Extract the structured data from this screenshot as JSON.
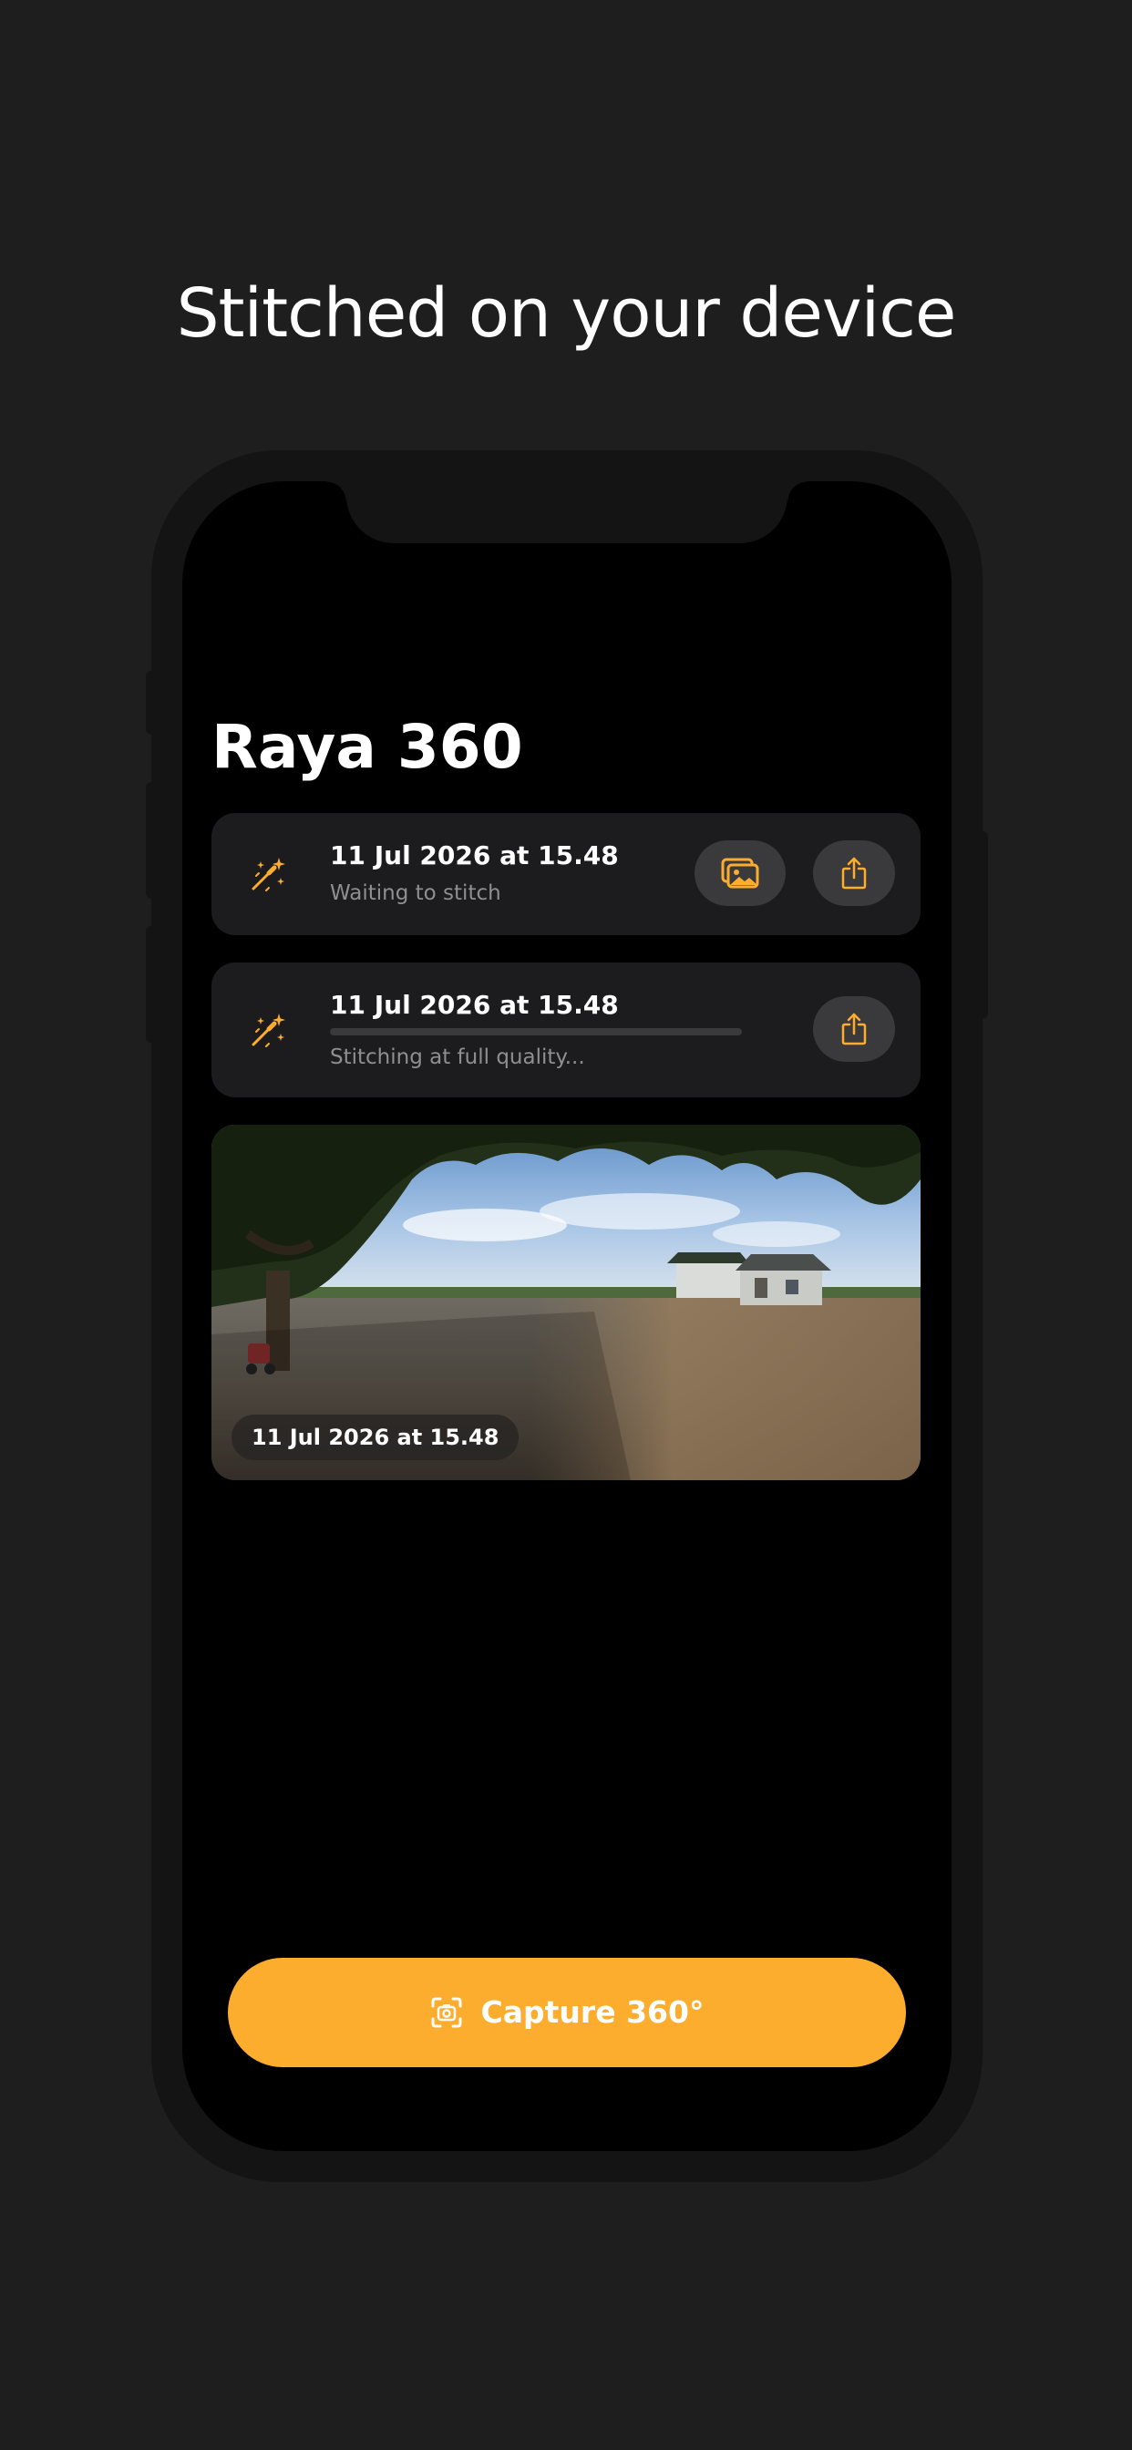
{
  "headline": "Stitched on your device",
  "app": {
    "title": "Raya 360"
  },
  "captures": [
    {
      "date": "11 Jul 2026 at 15.48",
      "status": "Waiting to stitch",
      "icon": "magic-wand-icon",
      "actions": [
        "photo-gallery-icon",
        "share-icon"
      ]
    },
    {
      "date": "11 Jul 2026 at 15.48",
      "status": "Stitching at full quality...",
      "icon": "magic-wand-icon",
      "progress": 0.0,
      "actions": [
        "share-icon"
      ]
    }
  ],
  "panorama": {
    "date": "11 Jul 2026 at 15.48"
  },
  "capture_button": {
    "label": "Capture 360°",
    "icon": "camera-viewfinder-icon"
  },
  "colors": {
    "page_background": "#1e1e1e",
    "screen_background": "#000000",
    "card_background": "#1c1c1e",
    "accent": "#fdad2e",
    "icon_button_background": "#3a3a3c"
  }
}
